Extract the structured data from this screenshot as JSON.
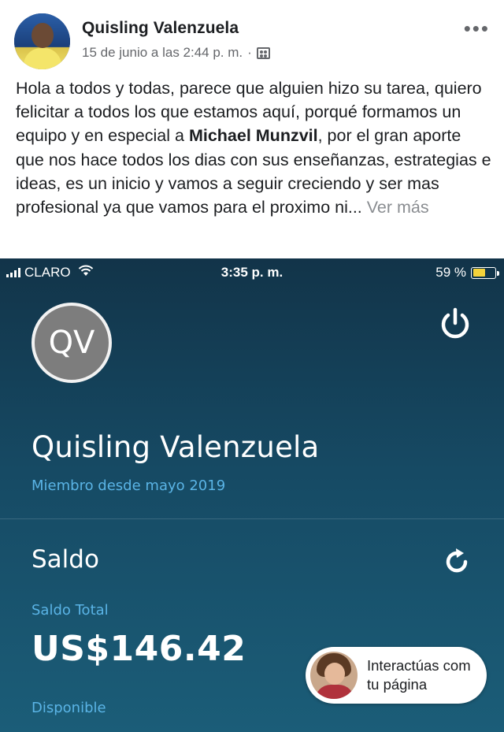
{
  "post": {
    "author": "Quisling Valenzuela",
    "timestamp": "15 de junio a las 2:44 p. m.",
    "separator": "·",
    "audience_icon": "group-page-icon",
    "more_label": "•••",
    "text_before": "Hola a todos y todas, parece que alguien hizo su tarea, quiero felicitar a todos los que estamos aquí, porqué formamos un equipo y en especial a ",
    "mention": "Michael Munzvil",
    "text_after": ", por el gran aporte que nos hace todos los dias con sus enseñanzas, estrategias e ideas, es un inicio y vamos a seguir creciendo y ser mas profesional ya que vamos para el proximo ni... ",
    "see_more": "Ver más"
  },
  "status_bar": {
    "carrier": "CLARO",
    "time": "3:35 p. m.",
    "battery": "59 %",
    "battery_level": 0.59,
    "battery_color": "#f5d33b"
  },
  "profile": {
    "initials": "QV",
    "name": "Quisling Valenzuela",
    "member_since": "Miembro desde mayo 2019"
  },
  "balance": {
    "heading": "Saldo",
    "total_label": "Saldo Total",
    "total_amount": "US$146.42",
    "available_label": "Disponible"
  },
  "chip": {
    "line1": "Interactúas com",
    "line2": "tu página"
  },
  "colors": {
    "accent_blue": "#5ab4e6",
    "app_background": "#164a64",
    "badge_gray": "#7d7d7d"
  }
}
